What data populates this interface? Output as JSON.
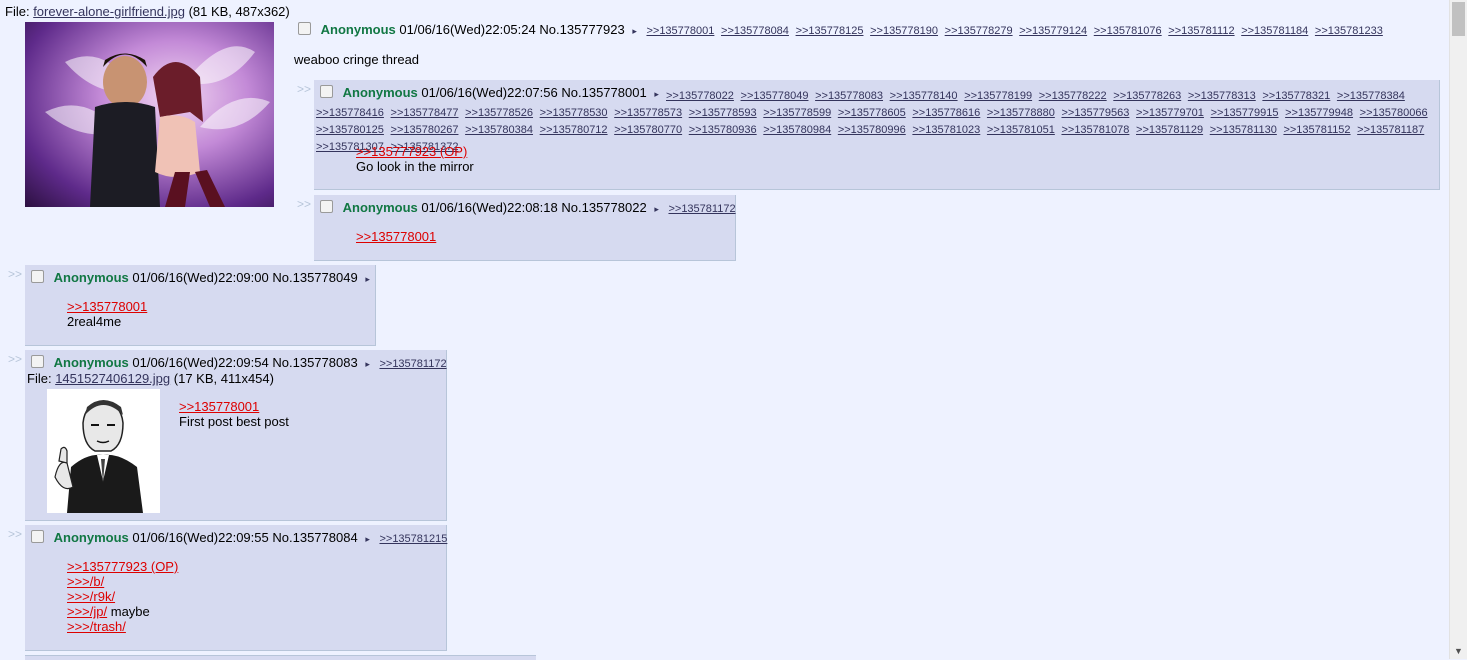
{
  "op": {
    "file_label": "File:",
    "file_name": "forever-alone-girlfriend.jpg",
    "file_meta": "(81 KB, 487x362)",
    "name": "Anonymous",
    "datetime": "01/06/16(Wed)22:05:24",
    "no": "No.135777923",
    "backlinks": [
      ">>135778001",
      ">>135778084",
      ">>135778125",
      ">>135778190",
      ">>135778279",
      ">>135779124",
      ">>135781076",
      ">>135781112",
      ">>135781184",
      ">>135781233"
    ],
    "message": "weaboo cringe thread"
  },
  "post_135778001": {
    "name": "Anonymous",
    "datetime": "01/06/16(Wed)22:07:56",
    "no": "No.135778001",
    "backlinks": [
      ">>135778022",
      ">>135778049",
      ">>135778083",
      ">>135778140",
      ">>135778199",
      ">>135778222",
      ">>135778263",
      ">>135778313",
      ">>135778321",
      ">>135778384",
      ">>135778416",
      ">>135778477",
      ">>135778526",
      ">>135778530",
      ">>135778573",
      ">>135778593",
      ">>135778599",
      ">>135778605",
      ">>135778616",
      ">>135778880",
      ">>135779563",
      ">>135779701",
      ">>135779915",
      ">>135779948",
      ">>135780066",
      ">>135780125",
      ">>135780267",
      ">>135780384",
      ">>135780712",
      ">>135780770",
      ">>135780936",
      ">>135780984",
      ">>135780996",
      ">>135781023",
      ">>135781051",
      ">>135781078",
      ">>135781129",
      ">>135781130",
      ">>135781152",
      ">>135781187",
      ">>135781307",
      ">>135781372"
    ],
    "quote": ">>135777923 (OP)",
    "text": "Go look in the mirror"
  },
  "post_135778022": {
    "name": "Anonymous",
    "datetime": "01/06/16(Wed)22:08:18",
    "no": "No.135778022",
    "backlinks": [
      ">>135781172"
    ],
    "quote": ">>135778001"
  },
  "post_135778049": {
    "name": "Anonymous",
    "datetime": "01/06/16(Wed)22:09:00",
    "no": "No.135778049",
    "quote": ">>135778001",
    "text": "2real4me"
  },
  "post_135778083": {
    "name": "Anonymous",
    "datetime": "01/06/16(Wed)22:09:54",
    "no": "No.135778083",
    "backlinks": [
      ">>135781172"
    ],
    "file_label": "File:",
    "file_name": "1451527406129.jpg",
    "file_meta": "(17 KB, 411x454)",
    "quote": ">>135778001",
    "text": "First post best post"
  },
  "post_135778084": {
    "name": "Anonymous",
    "datetime": "01/06/16(Wed)22:09:55",
    "no": "No.135778084",
    "backlinks": [
      ">>135781215"
    ],
    "lines": [
      {
        "link": ">>135777923 (OP)",
        "text": ""
      },
      {
        "link": ">>>/b/",
        "text": ""
      },
      {
        "link": ">>>/r9k/",
        "text": ""
      },
      {
        "link": ">>>/jp/",
        "text": " maybe"
      },
      {
        "link": ">>>/trash/",
        "text": ""
      }
    ]
  },
  "ui": {
    "side_arrows": ">>",
    "backlink_arrow": "▸",
    "scroll_up": "▲",
    "scroll_down": "▼"
  },
  "colors": {
    "bg": "#eef2ff",
    "reply_bg": "#d6daf0",
    "name": "#117743",
    "quote_link": "#dd0000",
    "link": "#34345c"
  }
}
